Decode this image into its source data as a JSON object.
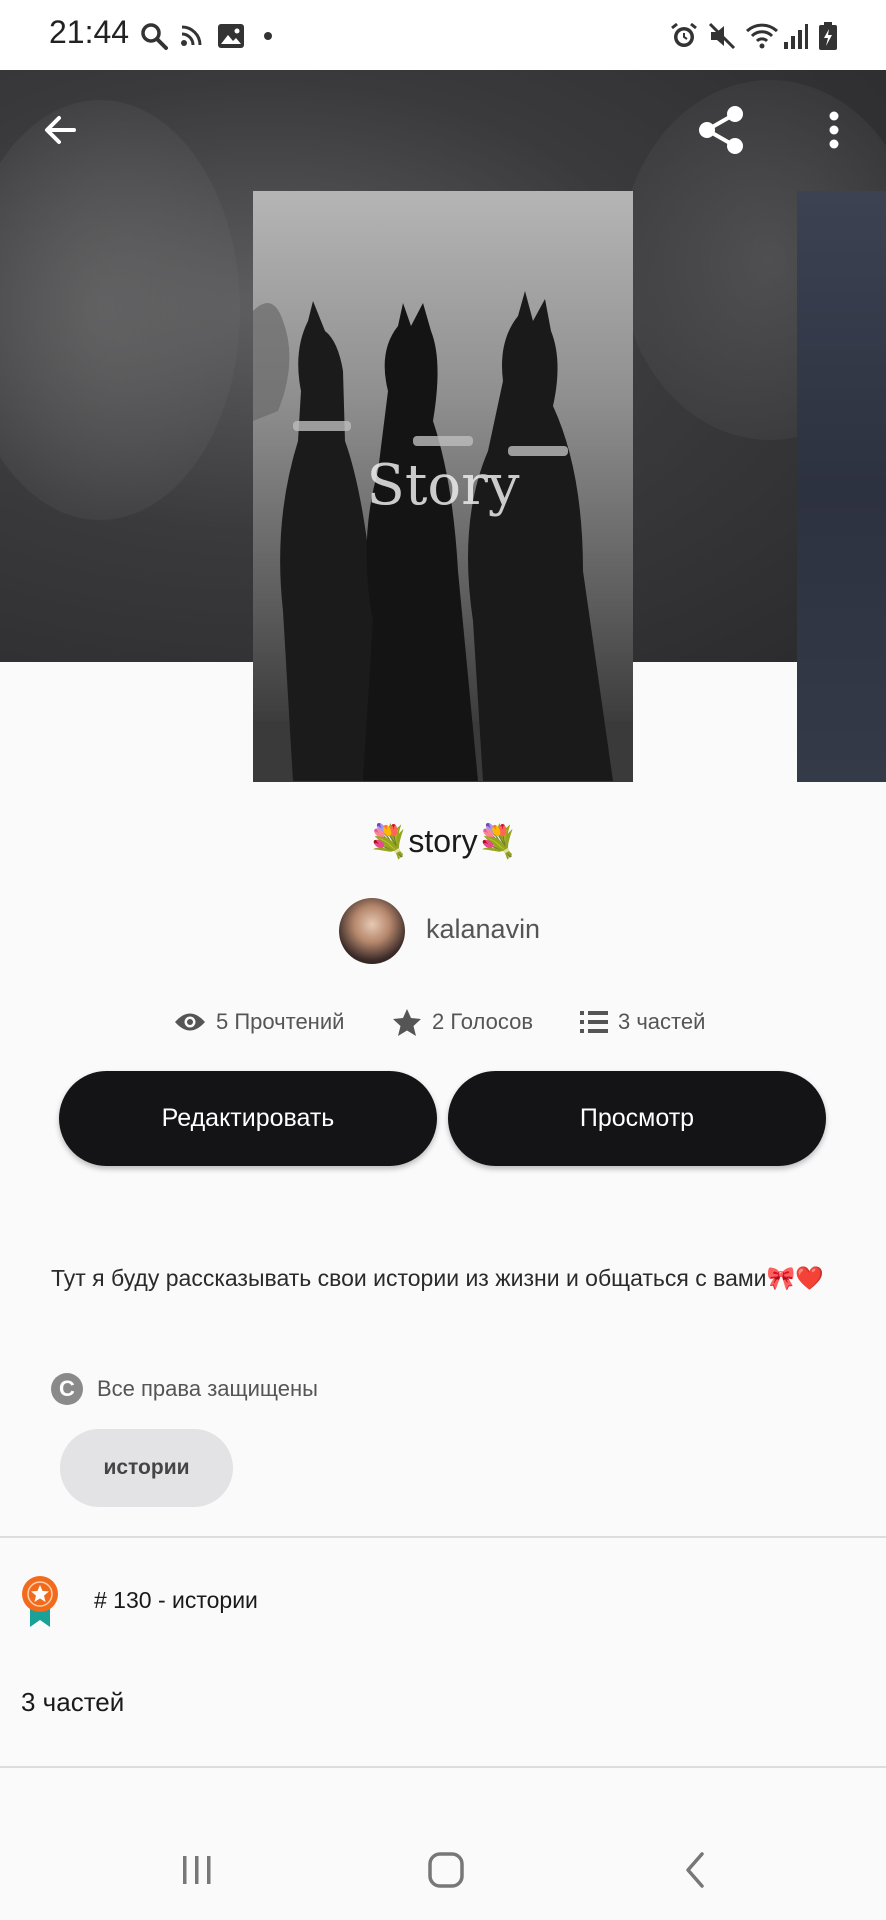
{
  "status_bar": {
    "time": "21:44",
    "left_icons": [
      "search-icon",
      "rss-icon",
      "image-icon",
      "dot-icon"
    ],
    "right_icons": [
      "alarm-icon",
      "mute-icon",
      "wifi-icon",
      "signal-icon",
      "battery-icon"
    ]
  },
  "header": {
    "back_icon": "back-arrow-icon",
    "share_icon": "share-icon",
    "menu_icon": "more-vertical-icon",
    "cover_text": "Story"
  },
  "story": {
    "title": "💐story💐",
    "author": "kalanavin",
    "reads": "5 Прочтений",
    "votes": "2 Голосов",
    "parts": "3 частей"
  },
  "actions": {
    "edit_label": "Редактировать",
    "view_label": "Просмотр"
  },
  "description": {
    "text": "Тут я буду рассказывать свои истории из жизни и общаться с вами🎀❤️"
  },
  "rights": {
    "label": "Все права защищены"
  },
  "tags": [
    "истории"
  ],
  "ranking": {
    "text": "# 130 - истории"
  },
  "parts_section": {
    "label": "3 частей"
  },
  "colors": {
    "button_bg": "#141316",
    "tag_bg": "#e3e2e5",
    "rank_orange": "#f26a1b",
    "rank_teal": "#1aa198"
  }
}
